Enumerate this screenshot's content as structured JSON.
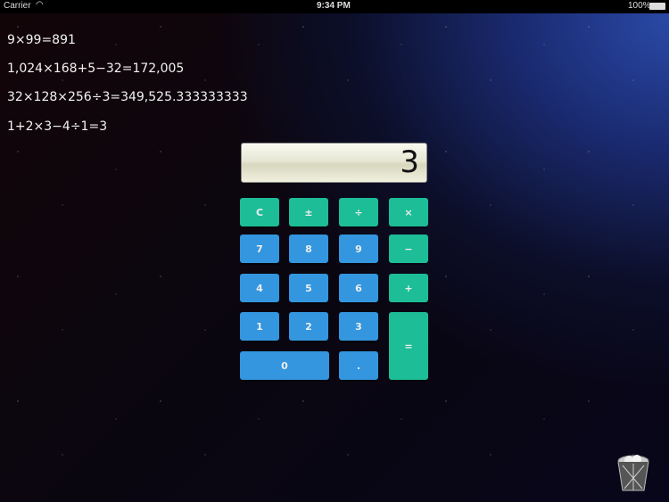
{
  "status": {
    "carrier": "Carrier",
    "time": "9:34 PM",
    "battery": "100%"
  },
  "history": [
    "9×99=891",
    "1,024×168+5−32=172,005",
    "32×128×256÷3=349,525.333333333",
    "1+2×3−4÷1=3"
  ],
  "display": "3",
  "buttons": {
    "clear": "C",
    "sign": "±",
    "divide": "÷",
    "multiply": "×",
    "seven": "7",
    "eight": "8",
    "nine": "9",
    "minus": "−",
    "four": "4",
    "five": "5",
    "six": "6",
    "plus": "+",
    "one": "1",
    "two": "2",
    "three": "3",
    "equals": "=",
    "zero": "0",
    "dot": "."
  },
  "colors": {
    "operator": "#1dbd97",
    "digit": "#3396de"
  }
}
